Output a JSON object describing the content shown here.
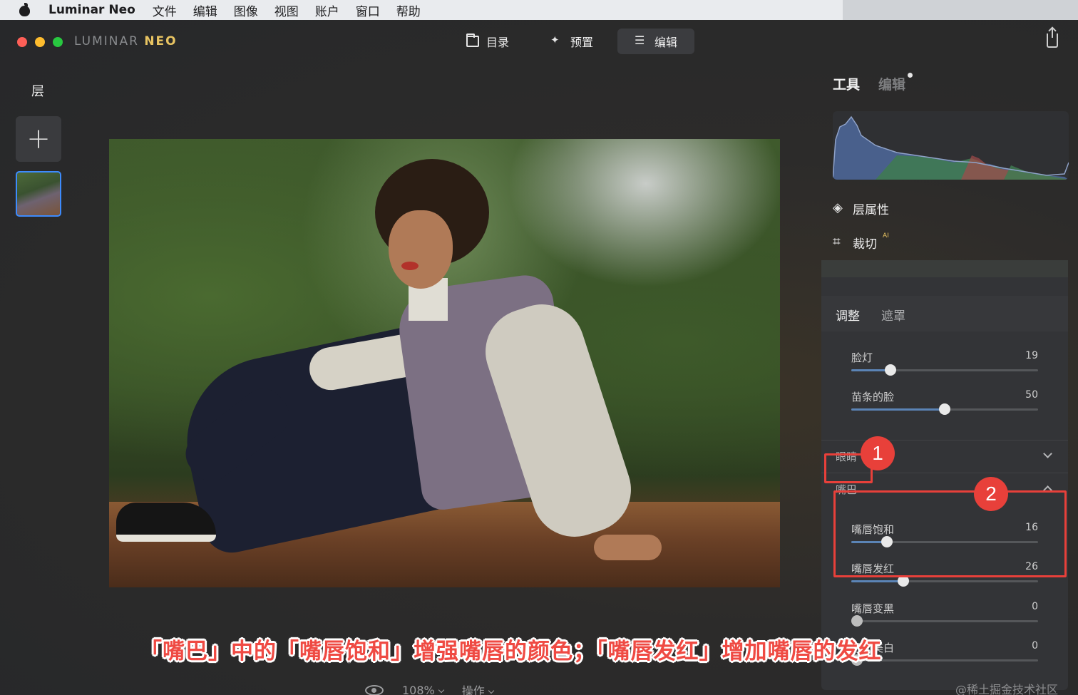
{
  "menubar": {
    "app_name": "Luminar Neo",
    "items": [
      "文件",
      "编辑",
      "图像",
      "视图",
      "账户",
      "窗口",
      "帮助"
    ]
  },
  "titlebar": {
    "brand_prefix": "LUMINAR",
    "brand_suffix": "NEO",
    "tabs": [
      {
        "label": "目录",
        "icon": "folder-icon",
        "active": false
      },
      {
        "label": "预置",
        "icon": "magic-wand-icon",
        "active": false
      },
      {
        "label": "编辑",
        "icon": "sliders-icon",
        "active": true
      }
    ]
  },
  "layers": {
    "title": "层",
    "add_symbol": "+"
  },
  "panel": {
    "tabs": {
      "tools": "工具",
      "edits": "编辑"
    },
    "layer_properties": "层属性",
    "crop": "裁切",
    "crop_badge": "AI",
    "sub_tabs": {
      "adjust": "调整",
      "mask": "遮罩"
    },
    "face_sliders": [
      {
        "label": "脸灯",
        "value": "19",
        "fraction": 0.21
      },
      {
        "label": "苗条的脸",
        "value": "50",
        "fraction": 0.5
      }
    ],
    "sections": {
      "eyes": "眼睛",
      "mouth": "嘴巴"
    },
    "mouth_sliders": [
      {
        "label": "嘴唇饱和",
        "value": "16",
        "fraction": 0.19
      },
      {
        "label": "嘴唇发红",
        "value": "26",
        "fraction": 0.28
      },
      {
        "label": "嘴唇变黑",
        "value": "0",
        "fraction": 0.03
      },
      {
        "label": "牙齿美白",
        "value": "0",
        "fraction": 0.03
      }
    ]
  },
  "annotations": {
    "badge_1": "1",
    "badge_2": "2",
    "caption": "「嘴巴」中的「嘴唇饱和」增强嘴唇的颜色；「嘴唇发红」增加嘴唇的发红"
  },
  "bottom_bar": {
    "zoom": "108%",
    "actions": "操作"
  },
  "watermark": "@稀土掘金技术社区",
  "colors": {
    "accent_blue": "#3d8bfd",
    "annotation_red": "#e8403a",
    "brand_gold": "#e8c462"
  }
}
